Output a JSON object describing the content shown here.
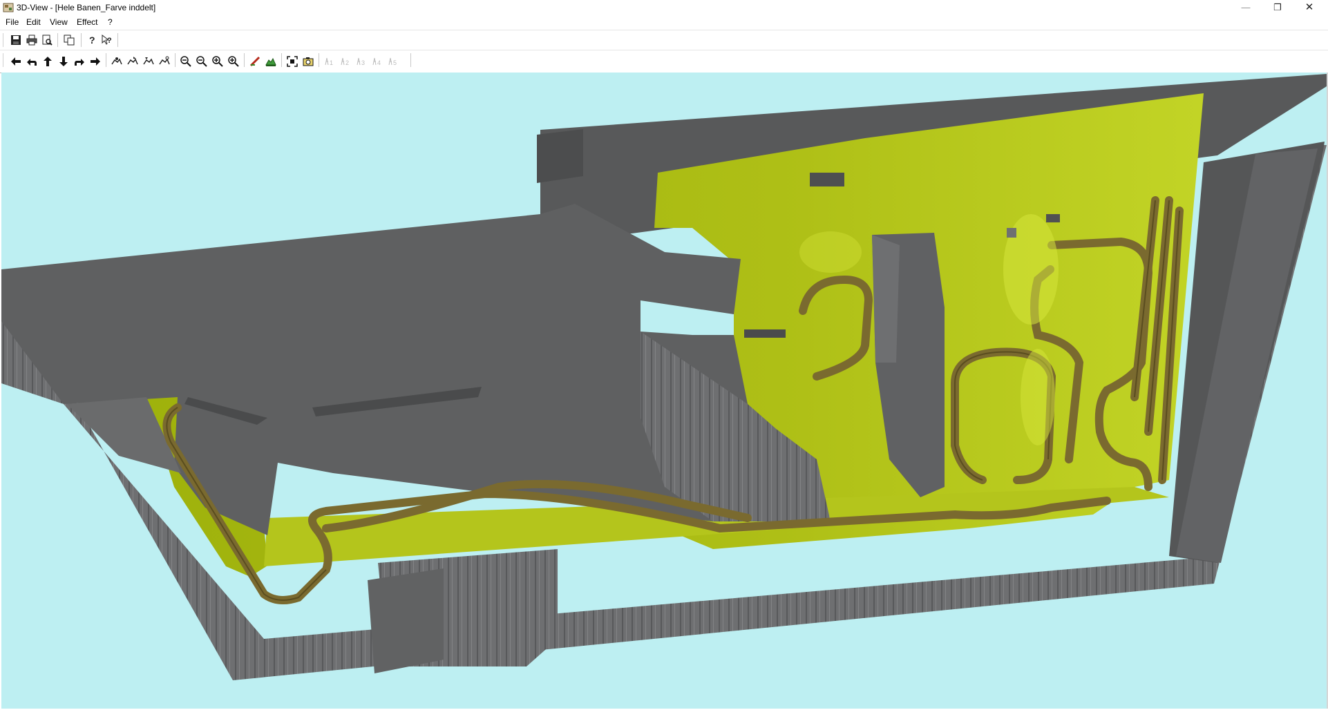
{
  "window": {
    "title": "3D-View - [Hele Banen_Farve inddelt]",
    "minimize_symbol": "—",
    "restore_symbol": "❐",
    "close_symbol": "✕"
  },
  "menu": {
    "items": [
      "File",
      "Edit",
      "View",
      "Effect",
      "?"
    ]
  },
  "toolbar1": {
    "buttons": [
      "save-icon",
      "print-icon",
      "print-preview-icon",
      "copy-icon",
      "help-icon",
      "context-help-icon"
    ]
  },
  "toolbar2": {
    "buttons": [
      "arrow-left-icon",
      "rotate-left-icon",
      "arrow-up-icon",
      "arrow-down-icon",
      "rotate-right-icon",
      "arrow-right-icon",
      "view-preset-1-icon",
      "view-preset-2-icon",
      "view-preset-3-icon",
      "view-preset-4-icon",
      "zoom-out-icon",
      "zoom-out-2-icon",
      "zoom-in-icon",
      "zoom-in-2-icon",
      "effect-icon",
      "terrain-icon",
      "fit-view-icon",
      "camera-icon",
      "train-1-icon",
      "train-2-icon",
      "train-3-icon",
      "train-4-icon",
      "train-5-icon"
    ],
    "train_labels": [
      "1",
      "2",
      "3",
      "4",
      "5"
    ]
  },
  "colors": {
    "background": "#bdeff2",
    "board_top": "#5e5f60",
    "board_side": "#6d6e70",
    "board_dark": "#4a4b4c",
    "terrain": "#a5b70e",
    "terrain_light": "#c7d82a",
    "track": "#7a6a2f"
  }
}
